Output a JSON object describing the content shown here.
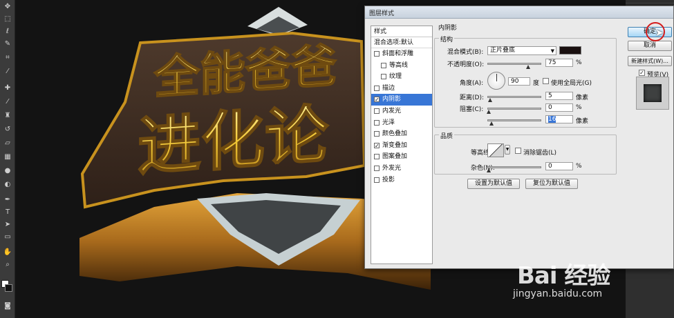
{
  "dialog": {
    "title": "图层样式",
    "styles_header": "样式",
    "blend_options": "混合选项:默认",
    "styles": [
      {
        "label": "斜面和浮雕",
        "checked": false,
        "indent": false,
        "selected": false
      },
      {
        "label": "等高线",
        "checked": false,
        "indent": true,
        "selected": false
      },
      {
        "label": "纹理",
        "checked": false,
        "indent": true,
        "selected": false
      },
      {
        "label": "描边",
        "checked": false,
        "indent": false,
        "selected": false
      },
      {
        "label": "内阴影",
        "checked": true,
        "indent": false,
        "selected": true
      },
      {
        "label": "内发光",
        "checked": false,
        "indent": false,
        "selected": false
      },
      {
        "label": "光泽",
        "checked": false,
        "indent": false,
        "selected": false
      },
      {
        "label": "颜色叠加",
        "checked": false,
        "indent": false,
        "selected": false
      },
      {
        "label": "渐变叠加",
        "checked": true,
        "indent": false,
        "selected": false
      },
      {
        "label": "图案叠加",
        "checked": false,
        "indent": false,
        "selected": false
      },
      {
        "label": "外发光",
        "checked": false,
        "indent": false,
        "selected": false
      },
      {
        "label": "投影",
        "checked": false,
        "indent": false,
        "selected": false
      }
    ],
    "section_title": "内阴影",
    "structure_title": "结构",
    "blend_mode_label": "混合模式(B):",
    "blend_mode_value": "正片叠底",
    "shadow_color": "#1a1010",
    "opacity_label": "不透明度(O):",
    "opacity_value": "75",
    "percent": "%",
    "angle_label": "角度(A):",
    "angle_value": "90",
    "degree": "度",
    "global_light_label": "使用全局光(G)",
    "distance_label": "距离(D):",
    "distance_value": "5",
    "pixels": "像素",
    "choke_label": "阻塞(C):",
    "choke_value": "0",
    "size_value": "16",
    "quality_title": "品质",
    "contour_label": "等高线:",
    "antialias_label": "消除锯齿(L)",
    "noise_label": "杂色(N):",
    "noise_value": "0",
    "set_default": "设置为默认值",
    "reset_default": "复位为默认值",
    "ok": "确定",
    "cancel": "取消",
    "new_style": "新建样式(W)...",
    "preview_label": "预览(V)",
    "preview_checked": "✓"
  },
  "artwork": {
    "line1": "全能爸爸",
    "line2": "进化论"
  },
  "watermark": {
    "logo": "Bai 经验",
    "url": "jingyan.baidu.com"
  }
}
